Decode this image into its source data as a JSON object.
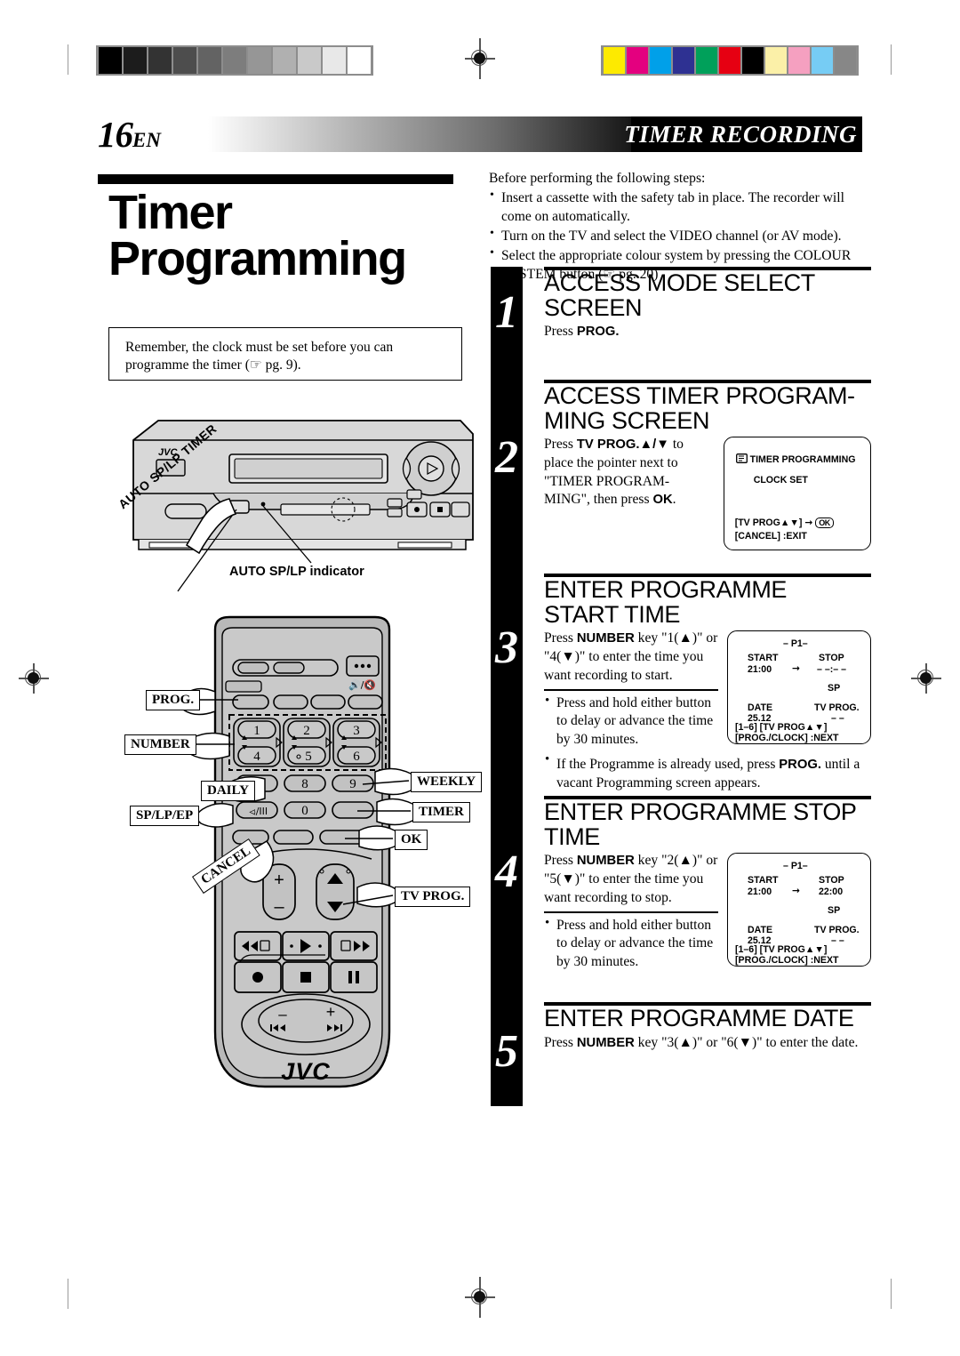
{
  "header": {
    "page_number": "16",
    "language": "EN",
    "section_title": "TIMER RECORDING"
  },
  "left": {
    "title_line1": "Timer",
    "title_line2": "Programming",
    "note": "Remember, the clock must be set before you can programme the timer (☞ pg. 9).",
    "vcr_indicator_label": "AUTO SP/LP indicator",
    "vcr_timer_label": "AUTO SP/LP TIMER",
    "vcr_brand": "JVC",
    "remote_brand": "JVC",
    "remote_callouts": [
      {
        "name": "prog",
        "label": "PROG."
      },
      {
        "name": "number",
        "label": "NUMBER"
      },
      {
        "name": "daily",
        "label": "DAILY"
      },
      {
        "name": "sp-lp-ep",
        "label": "SP/LP/EP"
      },
      {
        "name": "cancel",
        "label": "CANCEL"
      },
      {
        "name": "weekly",
        "label": "WEEKLY"
      },
      {
        "name": "timer",
        "label": "TIMER"
      },
      {
        "name": "ok",
        "label": "OK"
      },
      {
        "name": "tv-prog",
        "label": "TV PROG."
      }
    ],
    "remote_keys": [
      "1",
      "2",
      "3",
      "4",
      "5",
      "6",
      "8",
      "9",
      "0"
    ]
  },
  "right": {
    "intro_heading": "Before performing the following steps:",
    "intro_bullets": [
      "Insert a cassette with the safety tab in place. The recorder will come on automatically.",
      "Turn on the TV and select the VIDEO channel (or AV mode).",
      "Select the appropriate colour system by pressing the COLOUR SYSTEM button.(☞ pg. 20)"
    ],
    "steps": [
      {
        "number": "1",
        "heading": "ACCESS MODE SELECT SCREEN",
        "text": "Press PROG."
      },
      {
        "number": "2",
        "heading": "ACCESS TIMER PROGRAM- MING SCREEN",
        "text": "Press TV PROG.▲/▼ to place the pointer next to \"TIMER PROGRAM-MING\", then press OK."
      },
      {
        "number": "3",
        "heading": "ENTER PROGRAMME START TIME",
        "text": "Press NUMBER key \"1(▲)\" or \"4(▼)\" to enter the time you want recording to start.",
        "bullets": [
          "Press and hold either button to delay or advance the time by 30 minutes.",
          "If the Programme is already used, press PROG. until a vacant Programming screen appears."
        ]
      },
      {
        "number": "4",
        "heading": "ENTER PROGRAMME STOP TIME",
        "text": "Press NUMBER key \"2(▲)\" or \"5(▼)\" to enter the time you want recording to stop.",
        "bullets": [
          "Press and hold either button to delay or advance the time by 30 minutes."
        ]
      },
      {
        "number": "5",
        "heading": "ENTER PROGRAMME DATE",
        "text": "Press NUMBER key \"3(▲)\" or \"6(▼)\" to enter the date."
      }
    ],
    "osd_menu": {
      "pointer_icon": "pointing-hand-icon",
      "item1": "TIMER PROGRAMMING",
      "item2": "CLOCK SET",
      "hint1_left": "[TV PROG▲▼]",
      "hint1_arrow": "→",
      "hint1_ok": "OK",
      "hint2": "[CANCEL] :EXIT"
    },
    "osd_program_start": {
      "title": "– P1–",
      "start_label": "START",
      "start_value": "21:00",
      "arrow": "→",
      "stop_label": "STOP",
      "stop_value": "– –:– –",
      "speed": "SP",
      "date_label": "DATE",
      "date_value": "25.12",
      "tvprog_label": "TV PROG.",
      "tvprog_value": "– –",
      "hint1": "[1–6] [TV PROG▲▼]",
      "hint2": "[PROG./CLOCK] :NEXT"
    },
    "osd_program_stop": {
      "title": "– P1–",
      "start_label": "START",
      "start_value": "21:00",
      "arrow": "→",
      "stop_label": "STOP",
      "stop_value": "22:00",
      "speed": "SP",
      "date_label": "DATE",
      "date_value": "25.12",
      "tvprog_label": "TV PROG.",
      "tvprog_value": "– –",
      "hint1": "[1–6] [TV PROG▲▼]",
      "hint2": "[PROG./CLOCK] :NEXT"
    }
  },
  "print_marks": {
    "grayscale_steps": [
      "#000000",
      "#1c1c1c",
      "#333333",
      "#4d4d4d",
      "#636363",
      "#7d7d7d",
      "#969696",
      "#b0b0b0",
      "#c9c9c9",
      "#e8e8e8",
      "#ffffff"
    ],
    "color_swatches": [
      "#fdea00",
      "#e4007f",
      "#00a0e9",
      "#2e3192",
      "#00a05a",
      "#e60012",
      "#000000",
      "#fbf0a8",
      "#f5a0c0",
      "#76ccf4",
      "#878787"
    ]
  }
}
